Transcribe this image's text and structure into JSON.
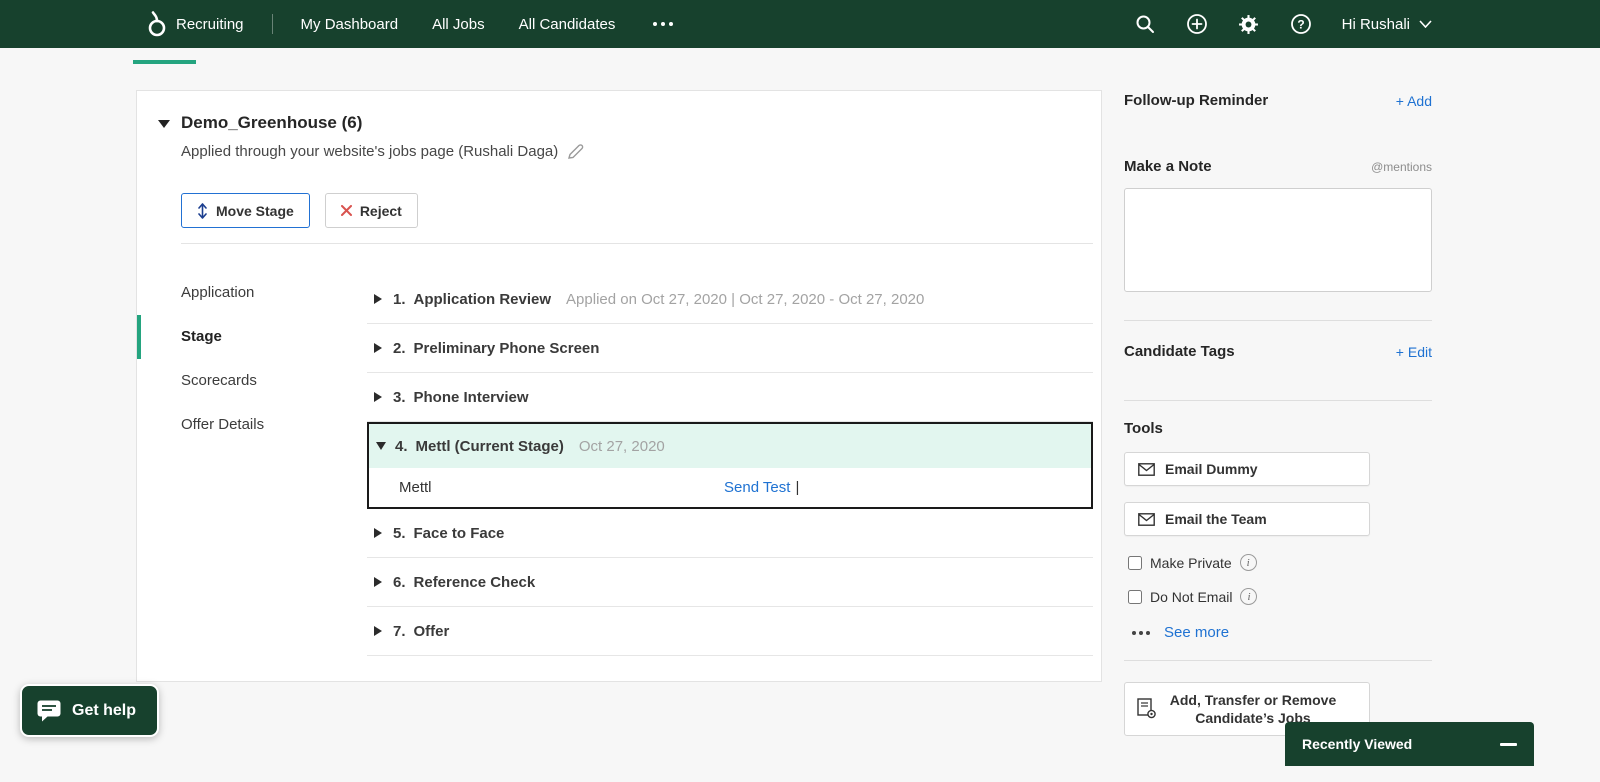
{
  "nav": {
    "brand": "Recruiting",
    "items": [
      {
        "label": "My Dashboard"
      },
      {
        "label": "All Jobs"
      },
      {
        "label": "All Candidates"
      }
    ],
    "greeting": "Hi Rushali"
  },
  "colors": {
    "nav_green": "#17412d",
    "accent_green": "#24a47f",
    "link_blue": "#1f72d2",
    "reject_red": "#d9534f",
    "current_stage_bg": "#e2f6ef"
  },
  "header": {
    "title": "Demo_Greenhouse (6)",
    "subtitle": "Applied through your website's jobs page (Rushali Daga)"
  },
  "actions": {
    "move_stage": "Move Stage",
    "reject": "Reject"
  },
  "tabs": [
    {
      "label": "Application"
    },
    {
      "label": "Stage"
    },
    {
      "label": "Scorecards"
    },
    {
      "label": "Offer Details"
    }
  ],
  "stages": [
    {
      "num": "1.",
      "name": "Application Review",
      "meta": "Applied on Oct 27, 2020 | Oct 27, 2020 - Oct 27, 2020"
    },
    {
      "num": "2.",
      "name": "Preliminary Phone Screen"
    },
    {
      "num": "3.",
      "name": "Phone Interview"
    },
    {
      "num": "4.",
      "name": "Mettl (Current Stage)",
      "meta": "Oct 27, 2020",
      "detail": {
        "label": "Mettl",
        "action": "Send Test",
        "separator": "|"
      }
    },
    {
      "num": "5.",
      "name": "Face to Face"
    },
    {
      "num": "6.",
      "name": "Reference Check"
    },
    {
      "num": "7.",
      "name": "Offer"
    }
  ],
  "sidebar": {
    "followup": {
      "title": "Follow-up Reminder",
      "add": "+ Add"
    },
    "note": {
      "title": "Make a Note",
      "mentions": "@mentions",
      "value": ""
    },
    "tags": {
      "title": "Candidate Tags",
      "edit": "+ Edit"
    },
    "tools": {
      "title": "Tools",
      "email_dummy": "Email Dummy",
      "email_team": "Email the Team",
      "make_private": "Make Private",
      "do_not_email": "Do Not Email",
      "see_more": "See more",
      "jobs_button": "Add, Transfer or Remove Candidate’s Jobs"
    }
  },
  "floating": {
    "get_help": "Get help",
    "recently_viewed": "Recently Viewed"
  }
}
